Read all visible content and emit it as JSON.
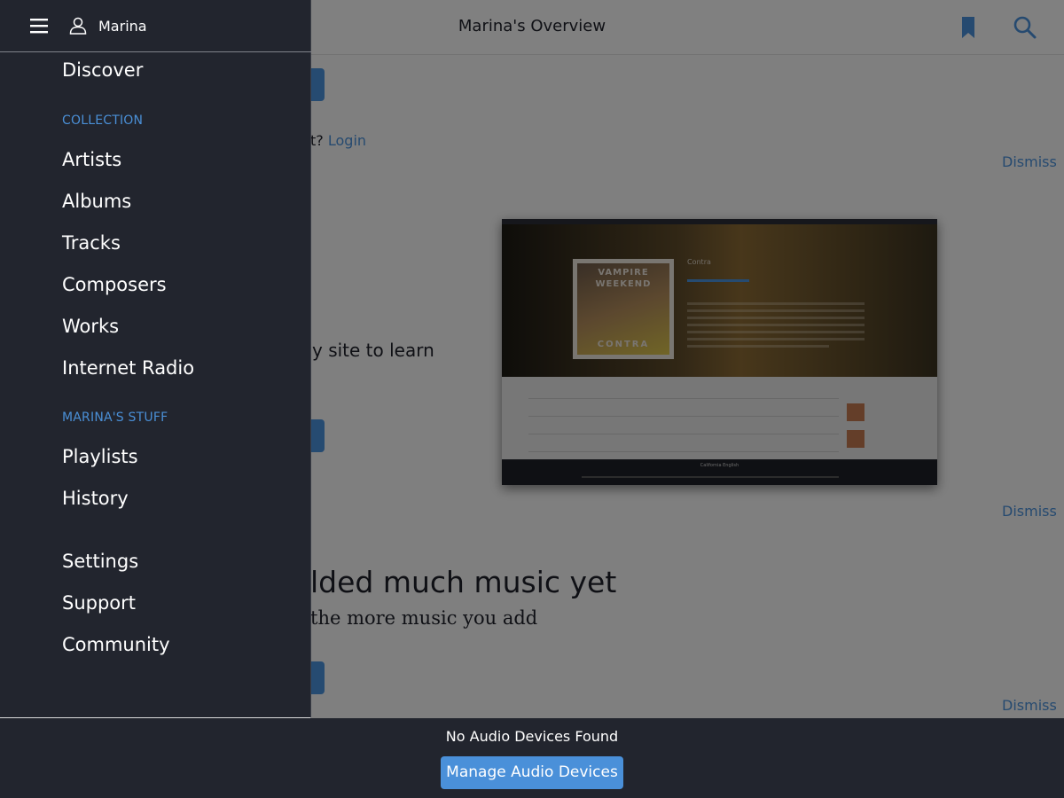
{
  "topbar": {
    "title": "Marina's Overview",
    "bookmark_icon": "bookmark-icon",
    "search_icon": "search-icon"
  },
  "main": {
    "login_prefix": "t?",
    "login_link": "Login",
    "learn_text": "y site to learn",
    "no_music_heading": "lded much music yet",
    "no_music_subtext": "the more music you add",
    "dismiss_label": "Dismiss",
    "preview": {
      "cover_top": "VAMPIRE WEEKEND",
      "cover_bottom": "CONTRA",
      "album_title": "Contra",
      "player_track": "California English"
    }
  },
  "sidebar": {
    "user_name": "Marina",
    "menu_icon": "hamburger-icon",
    "user_icon": "user-icon",
    "discover": "Discover",
    "collection_header": "COLLECTION",
    "collection_items": [
      "Artists",
      "Albums",
      "Tracks",
      "Composers",
      "Works",
      "Internet Radio"
    ],
    "stuff_header": "MARINA'S STUFF",
    "stuff_items": [
      "Playlists",
      "History"
    ],
    "footer_items": [
      "Settings",
      "Support",
      "Community"
    ]
  },
  "audio_bar": {
    "status": "No Audio Devices Found",
    "manage_button": "Manage Audio Devices"
  },
  "colors": {
    "accent": "#4a90d9",
    "sidebar_bg": "#22252e",
    "section_header": "#4a8fd6"
  }
}
